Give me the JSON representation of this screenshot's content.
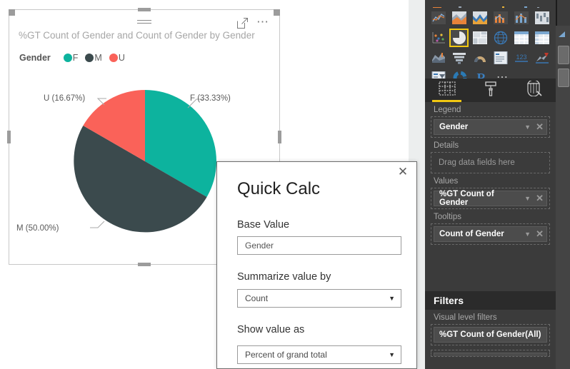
{
  "visual": {
    "title": "%GT Count of Gender and Count of Gender by Gender",
    "hamburger_icon": "hamburger-icon",
    "focus_icon": "focus-mode-icon",
    "more_icon": "more-options-icon",
    "legend": {
      "title": "Gender",
      "items": [
        {
          "label": "F",
          "color": "#0db39e"
        },
        {
          "label": "M",
          "color": "#3b4a4d"
        },
        {
          "label": "U",
          "color": "#fa6259"
        }
      ]
    }
  },
  "chart_data": {
    "type": "pie",
    "title": "%GT Count of Gender and Count of Gender by Gender",
    "legend_title": "Gender",
    "legend_position": "top-left",
    "categories": [
      "F",
      "M",
      "U"
    ],
    "values": [
      33.33,
      50.0,
      16.67
    ],
    "colors": [
      "#0db39e",
      "#3b4a4d",
      "#fa6259"
    ],
    "labels": [
      "F (33.33%)",
      "M (50.00%)",
      "U (16.67%)"
    ],
    "units": "percent",
    "start_angle_deg": 0,
    "direction": "clockwise"
  },
  "dialog": {
    "title": "Quick Calc",
    "close_icon": "close-icon",
    "base_value_label": "Base Value",
    "base_value": "Gender",
    "summarize_label": "Summarize value by",
    "summarize_value": "Count",
    "show_value_label": "Show value as",
    "show_value": "Percent of grand total",
    "caret_icon": "chevron-down-icon"
  },
  "pane": {
    "gallery": {
      "rows": [
        [
          "stacked-bar-chart-icon",
          "clustered-column-chart-icon",
          "stacked-area-chart-icon",
          "ribbon-chart-icon",
          "waterfall-chart-icon",
          "funnel-partial-icon"
        ],
        [
          "line-chart-icon",
          "area-chart-icon",
          "stacked-area-chart-icon",
          "line-and-stacked-column-chart-icon",
          "line-and-clustered-column-chart-icon",
          "waterfall-chart-icon"
        ],
        [
          "scatter-chart-icon",
          "pie-chart-icon",
          "treemap-icon",
          "map-icon",
          "table-icon",
          "matrix-icon"
        ],
        [
          "filled-map-icon",
          "funnel-chart-icon",
          "gauge-chart-icon",
          "multi-row-card-icon",
          "card-icon",
          "kpi-icon"
        ],
        [
          "slicer-icon",
          "donut-chart-icon",
          "r-script-visual-icon",
          "more-visuals-icon"
        ]
      ],
      "selected": "pie-chart-icon"
    },
    "tabs": [
      {
        "name": "fields-tab",
        "icon": "fields-icon",
        "active": true
      },
      {
        "name": "format-tab",
        "icon": "paint-roller-icon",
        "active": false
      },
      {
        "name": "analytics-tab",
        "icon": "magnifier-chart-icon",
        "active": false
      }
    ],
    "wells": [
      {
        "label": "Legend",
        "chip": "Gender",
        "empty": false
      },
      {
        "label": "Details",
        "chip": "Drag data fields here",
        "empty": true
      },
      {
        "label": "Values",
        "chip": "%GT Count of Gender",
        "empty": false
      },
      {
        "label": "Tooltips",
        "chip": "Count of Gender",
        "empty": false
      }
    ],
    "filters": {
      "header": "Filters",
      "section_label": "Visual level filters",
      "items": [
        "%GT Count of Gender(All)"
      ]
    },
    "chip_caret_icon": "chevron-down-icon",
    "chip_remove_icon": "remove-field-icon"
  }
}
